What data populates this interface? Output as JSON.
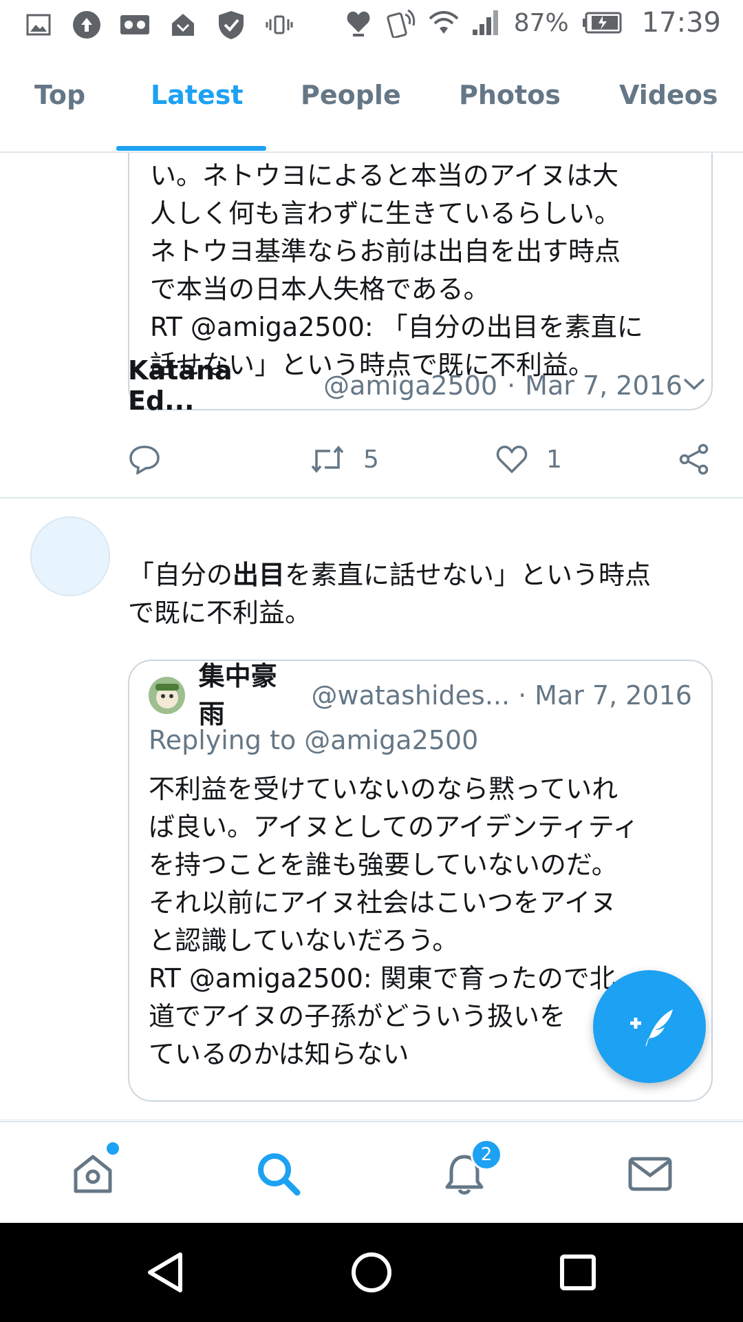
{
  "status_bar": {
    "battery": "87%",
    "time": "17:39",
    "icons": [
      "image-icon",
      "upload-icon",
      "voicemail-icon",
      "inbox-icon",
      "shield-icon",
      "vibrate-icon",
      "heart-location-icon",
      "nfc-icon",
      "wifi-icon",
      "signal-icon",
      "battery-icon"
    ]
  },
  "tabs": [
    {
      "label": "Top"
    },
    {
      "label": "Latest"
    },
    {
      "label": "People"
    },
    {
      "label": "Photos"
    },
    {
      "label": "Videos"
    }
  ],
  "tabs_active": "Latest",
  "top_card": {
    "lines": [
      "い。ネトウヨによると本当のアイヌは大",
      "人しく何も言わずに生きているらしい。",
      "ネトウヨ基準ならお前は出自を出す時点",
      "で本当の日本人失格である。",
      "RT @amiga2500: 「自分の出目を素直に",
      "話せない」という時点で既に不利益。"
    ]
  },
  "top_actions": {
    "retweets": "5",
    "likes": "1"
  },
  "tweet": {
    "name": "Katana Ed...",
    "handle": "@amiga2500",
    "sep": "·",
    "date": "Mar 7, 2016",
    "text_line1_a": "「自分の",
    "text_line1_b": "出目",
    "text_line1_c": "を素直に話せない」という時点",
    "text_line2": "で既に不利益。"
  },
  "quoted": {
    "name": "集中豪雨",
    "handle": "@watashides...",
    "sep": "·",
    "date": "Mar 7, 2016",
    "replying": "Replying to @amiga2500",
    "lines": [
      "不利益を受けていないのなら黙っていれ",
      "ば良い。アイヌとしてのアイデンティティ",
      "を持つことを誰も強要していないのだ。",
      "それ以前にアイヌ社会はこいつをアイヌ",
      "と認識していないだろう。",
      "RT @amiga2500: 関東で育ったので北",
      "道でアイヌの子孫がどういう扱いを",
      "ているのかは知らない"
    ]
  },
  "bottom_nav": {
    "notifications_badge": "2"
  },
  "colors": {
    "accent": "#1da1f2",
    "muted": "#657786",
    "border": "#ccd6dd"
  }
}
